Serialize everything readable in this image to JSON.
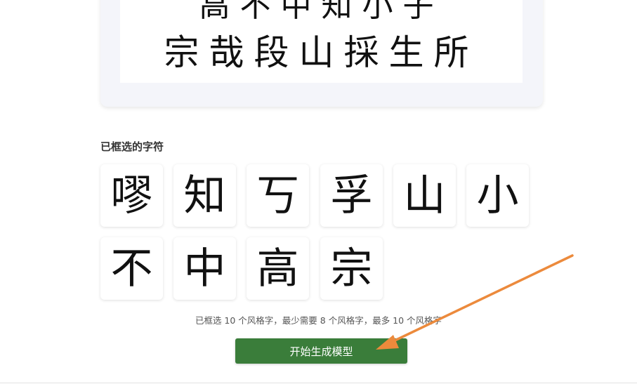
{
  "preview": {
    "row_top": "高不中知小子",
    "row_bottom": "宗哉段山採生所"
  },
  "selected": {
    "title": "已框选的字符",
    "chars": [
      "嘐",
      "知",
      "丂",
      "孚",
      "山",
      "小",
      "不",
      "中",
      "高",
      "宗"
    ]
  },
  "hint_text": "已框选 10 个风格字，最少需要 8 个风格字，最多 10 个风格字",
  "start_button_label": "开始生成模型",
  "colors": {
    "button": "#3a7d3a",
    "arrow": "#ec8a3c",
    "card_bg": "#f4f5fa"
  }
}
